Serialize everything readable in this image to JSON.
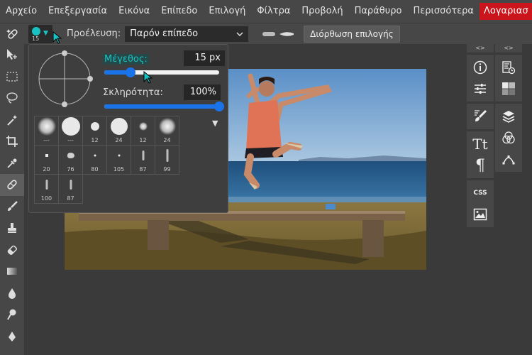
{
  "menu": {
    "items": [
      "Αρχείο",
      "Επεξεργασία",
      "Εικόνα",
      "Επίπεδο",
      "Επιλογή",
      "Φίλτρα",
      "Προβολή",
      "Παράθυρο",
      "Περισσότερα"
    ],
    "account": "Λογαριασ"
  },
  "options": {
    "brush_size": "15",
    "source_label": "Προέλευση:",
    "source_value": "Παρόν επίπεδο",
    "fix_button": "Διόρθωση επιλογής"
  },
  "toolbar": {
    "tools": [
      "move-tool",
      "marquee-tool",
      "lasso-tool",
      "magic-wand-tool",
      "crop-tool",
      "eyedropper-tool",
      "healing-brush-tool",
      "brush-tool",
      "clone-stamp-tool",
      "eraser-tool",
      "gradient-tool",
      "blur-tool",
      "dodge-tool",
      "pen-tool"
    ],
    "active": "healing-brush-tool"
  },
  "brush_popup": {
    "size_label": "Μέγεθος:",
    "size_value": "15  px",
    "size_fraction": 0.23,
    "hardness_label": "Σκληρότητα:",
    "hardness_value": "100%",
    "hardness_fraction": 1.0,
    "presets": [
      {
        "label": "---",
        "kind": "soft",
        "d": 26
      },
      {
        "label": "---",
        "kind": "hard",
        "d": 26
      },
      {
        "label": "12",
        "kind": "hard",
        "d": 12
      },
      {
        "label": "24",
        "kind": "hard",
        "d": 24
      },
      {
        "label": "12",
        "kind": "soft",
        "d": 12
      },
      {
        "label": "24",
        "kind": "soft",
        "d": 24
      },
      {
        "label": "20",
        "kind": "square",
        "d": 4
      },
      {
        "label": "76",
        "kind": "blob",
        "d": 10
      },
      {
        "label": "80",
        "kind": "dot",
        "d": 3
      },
      {
        "label": "105",
        "kind": "dot",
        "d": 3
      },
      {
        "label": "87",
        "kind": "stroke",
        "d": 14
      },
      {
        "label": "99",
        "kind": "stroke",
        "d": 18
      },
      {
        "label": "100",
        "kind": "stroke",
        "d": 14
      },
      {
        "label": "87",
        "kind": "stroke",
        "d": 14
      }
    ]
  },
  "right_panels": {
    "col1_head": "<>",
    "col2_head": "<>",
    "col1": [
      "info-icon",
      "adjustments-icon",
      "brush-panel-icon",
      "character-icon",
      "paragraph-icon",
      "css-icon",
      "image-icon"
    ],
    "col2": [
      "history-icon",
      "swatches-icon",
      "layers-icon",
      "channels-icon",
      "paths-icon"
    ],
    "tt": "Tt",
    "pilcrow": "¶",
    "css": "CSS"
  },
  "colors": {
    "accent": "#19c2c2",
    "slider": "#1a73e8",
    "account_bg": "#c9151b"
  }
}
